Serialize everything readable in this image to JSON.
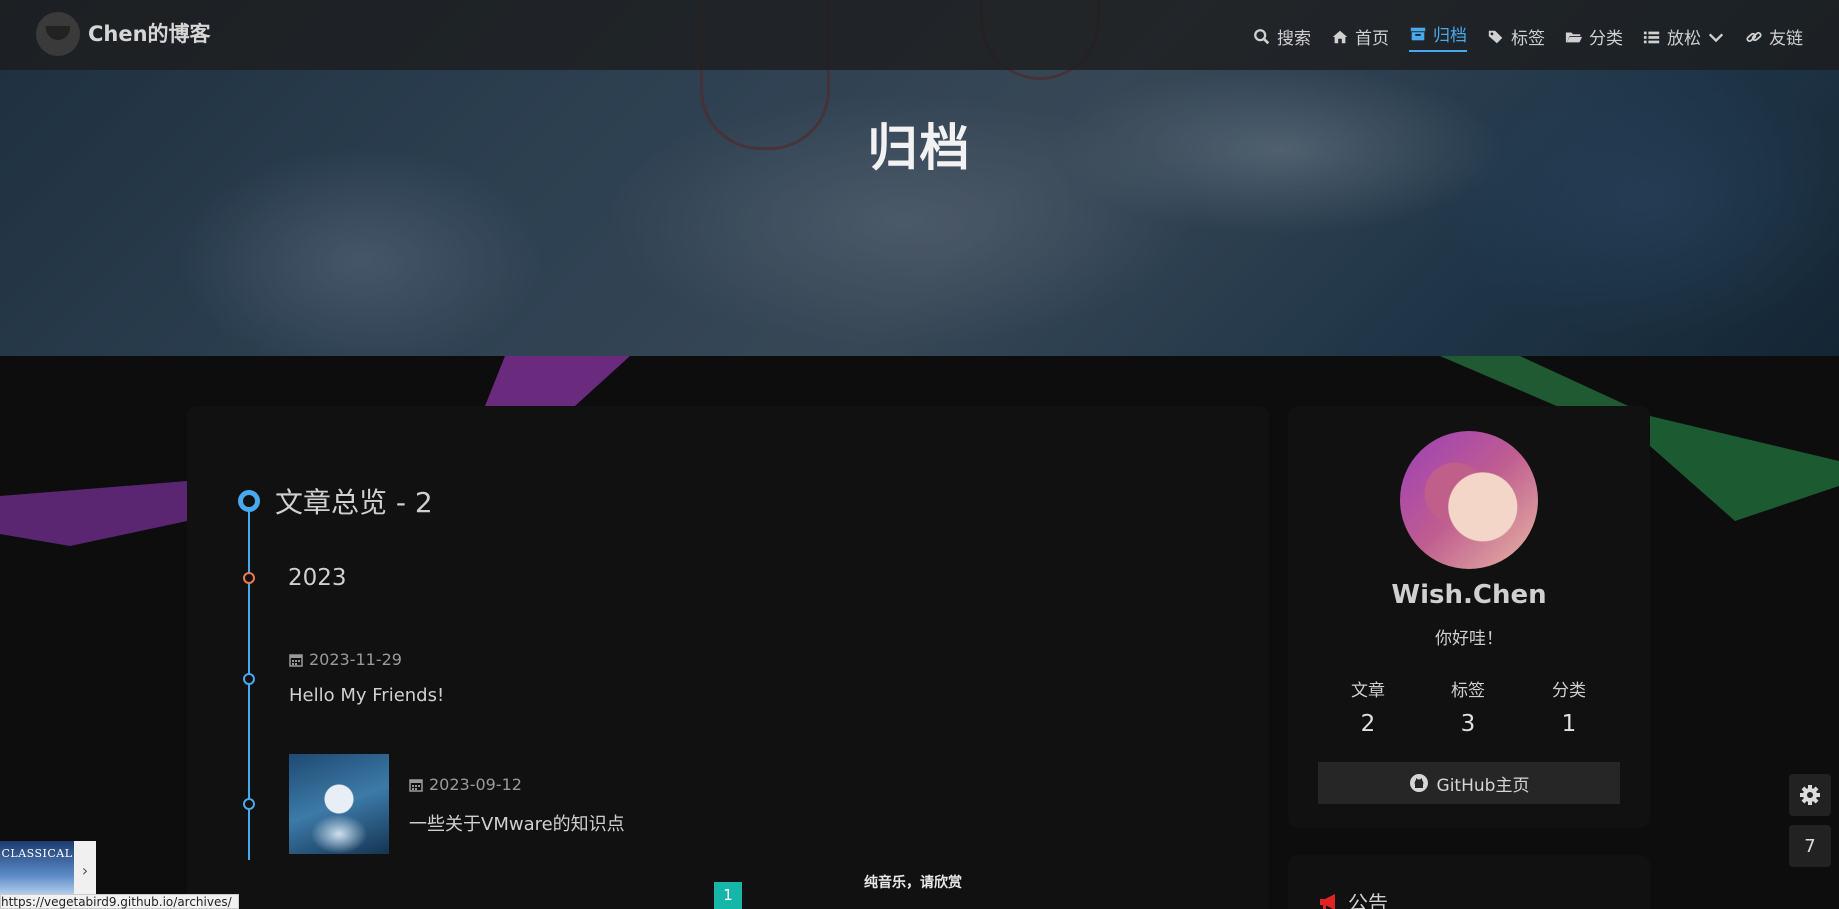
{
  "nav": {
    "brand": "Chen的博客",
    "items": [
      {
        "label": "搜索",
        "icon": "search-icon"
      },
      {
        "label": "首页",
        "icon": "home-icon"
      },
      {
        "label": "归档",
        "icon": "archive-icon",
        "active": true
      },
      {
        "label": "标签",
        "icon": "tags-icon"
      },
      {
        "label": "分类",
        "icon": "folder-icon"
      },
      {
        "label": "放松",
        "icon": "list-icon"
      },
      {
        "label": "友链",
        "icon": "link-icon"
      }
    ]
  },
  "hero": {
    "title": "归档"
  },
  "archive": {
    "heading": "文章总览 - 2",
    "year": "2023",
    "posts": [
      {
        "date": "2023-11-29",
        "title": "Hello My Friends!"
      },
      {
        "date": "2023-09-12",
        "title": "一些关于VMware的知识点"
      }
    ]
  },
  "profile": {
    "name": "Wish.Chen",
    "description": "你好哇！",
    "stats": [
      {
        "label": "文章",
        "value": "2"
      },
      {
        "label": "标签",
        "value": "3"
      },
      {
        "label": "分类",
        "value": "1"
      }
    ],
    "github_label": "GitHub主页"
  },
  "notice": {
    "title": "公告"
  },
  "floating": {
    "settings_icon": "gear-icon",
    "counter": "7"
  },
  "music": {
    "cover_text": "CLASSICAL",
    "caption": "纯音乐，请欣赏"
  },
  "pagination": {
    "current": "1"
  },
  "status_url": "https://vegetabird9.github.io/archives/",
  "colors": {
    "accent": "#49a9ee",
    "year_dot": "#ef7a4a",
    "page_active": "#16b6a8"
  }
}
